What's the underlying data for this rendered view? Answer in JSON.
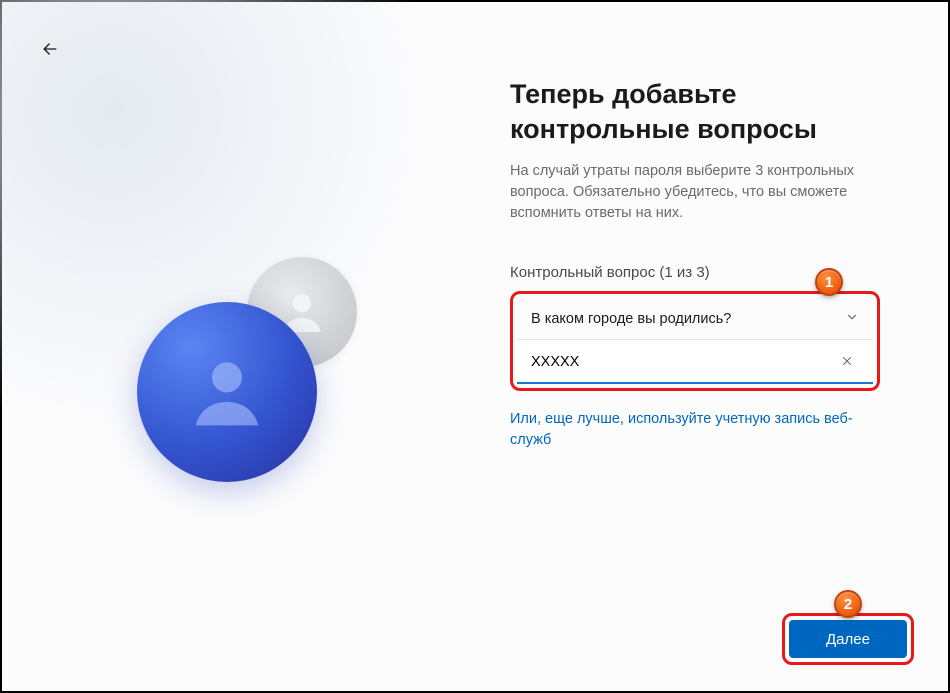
{
  "header": {
    "title": "Теперь добавьте контрольные вопросы",
    "subtitle": "На случай утраты пароля выберите 3 контрольных вопроса. Обязательно убедитесь, что вы сможете вспомнить ответы на них."
  },
  "question": {
    "section_label": "Контрольный вопрос (1 из 3)",
    "selected": "В каком городе вы родились?",
    "answer_value": "XXXXX"
  },
  "link_text": "Или, еще лучше, используйте учетную запись веб-служб",
  "next_label": "Далее",
  "annotations": {
    "badge1": "1",
    "badge2": "2"
  }
}
